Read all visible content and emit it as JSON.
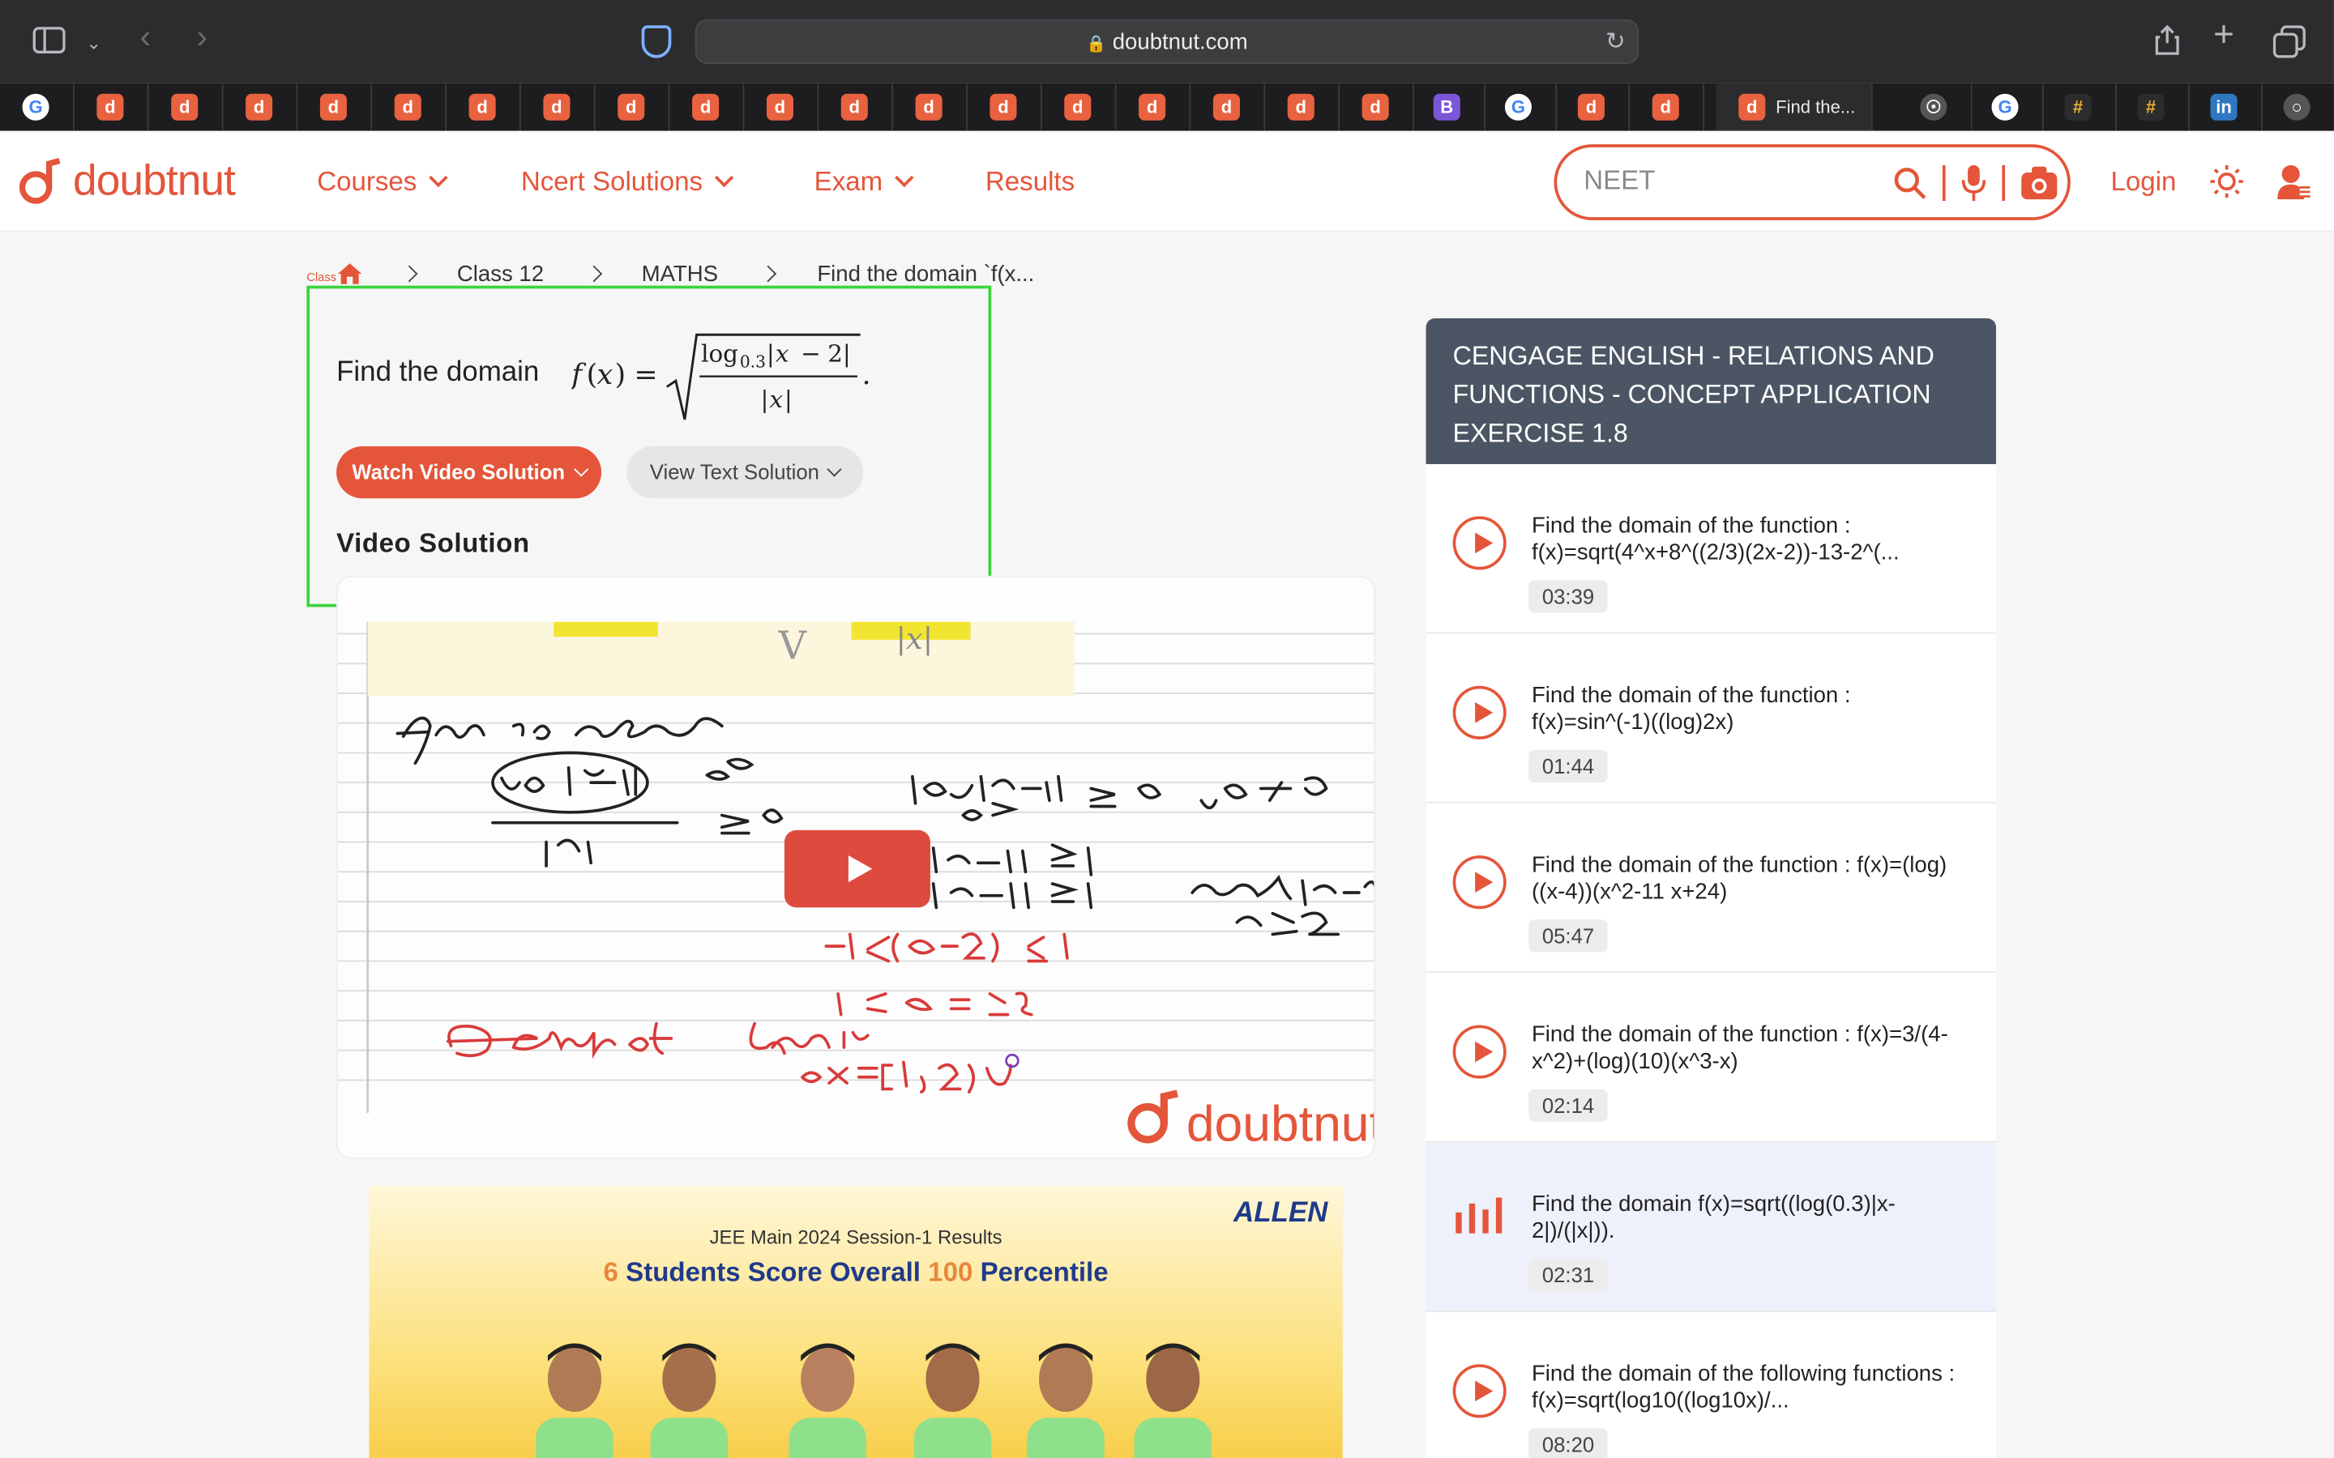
{
  "browser": {
    "url": "doubtnut.com",
    "active_tab_label": "Find the..."
  },
  "site": {
    "logo": "doubtnut",
    "nav": [
      "Courses",
      "Ncert Solutions",
      "Exam",
      "Results"
    ],
    "search_placeholder": "NEET",
    "login": "Login",
    "brand_color": "#e4553a"
  },
  "breadcrumb": {
    "tiny": "Class",
    "items": [
      "Class 12",
      "MATHS",
      "Find the domain `f(x..."
    ]
  },
  "question": {
    "prefix": "Find the domain",
    "watch_button": "Watch Video Solution",
    "text_button": "View Text Solution",
    "video_heading": "Video Solution"
  },
  "video": {
    "watermark": "doubtnut"
  },
  "ad": {
    "brand": "ALLEN",
    "line1": "JEE Main 2024 Session-1 Results",
    "line2_num1": "6",
    "line2_mid": "Students Score Overall",
    "line2_num2": "100",
    "line2_end": "Percentile"
  },
  "sidebar": {
    "heading": "CENGAGE ENGLISH  -  RELATIONS AND FUNCTIONS  -  CONCEPT APPLICATION EXERCISE 1.8",
    "items": [
      {
        "title": "Find the domain of the function : f(x)=sqrt(4^x+8^((2/3)(2x-2))-13-2^(...",
        "time": "03:39"
      },
      {
        "title": "Find the domain of the function : f(x)=sin^(-1)((log)2x)",
        "time": "01:44"
      },
      {
        "title": "Find the domain of the function : f(x)=(log)((x-4))(x^2-11 x+24)",
        "time": "05:47"
      },
      {
        "title": "Find the domain of the function : f(x)=3/(4-x^2)+(log)(10)(x^3-x)",
        "time": "02:14"
      },
      {
        "title": "Find the domain f(x)=sqrt((log(0.3)|x-2|)/(|x|)).",
        "time": "02:31"
      },
      {
        "title": "Find the domain of the following functions : f(x)=sqrt(log10((log10x)/...",
        "time": "08:20"
      }
    ]
  }
}
